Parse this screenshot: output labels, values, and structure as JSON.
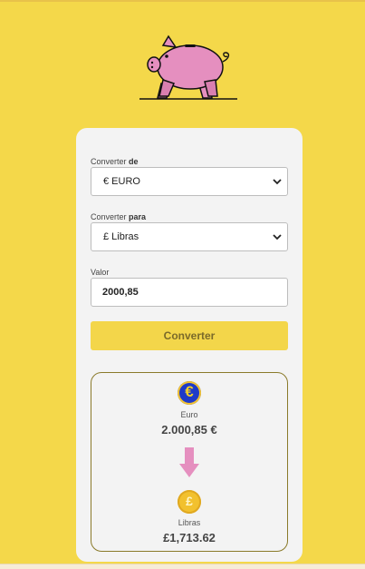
{
  "form": {
    "from_label_plain": "Converter",
    "from_label_bold": "de",
    "from_value": "€ EURO",
    "to_label_plain": "Converter",
    "to_label_bold": "para",
    "to_value": "£ Libras",
    "amount_label": "Valor",
    "amount_value": "2000,85",
    "convert_button": "Converter"
  },
  "result": {
    "from_currency_symbol": "€",
    "from_currency_name": "Euro",
    "from_amount": "2.000,85 €",
    "to_currency_symbol": "£",
    "to_currency_name": "Libras",
    "to_amount": "£1,713.62"
  },
  "icons": {
    "logo": "piggy-bank-icon",
    "from_coin": "euro-coin-icon",
    "to_coin": "pound-coin-icon",
    "arrow": "arrow-down-icon",
    "chevron": "chevron-down-icon"
  },
  "colors": {
    "background": "#f4d84a",
    "card": "#f3f3f3",
    "button": "#f3d64a",
    "pig": "#e58fbf",
    "arrow": "#e58fbf",
    "euro_coin": "#1e3ac8",
    "pound_coin": "#f2c12e"
  }
}
